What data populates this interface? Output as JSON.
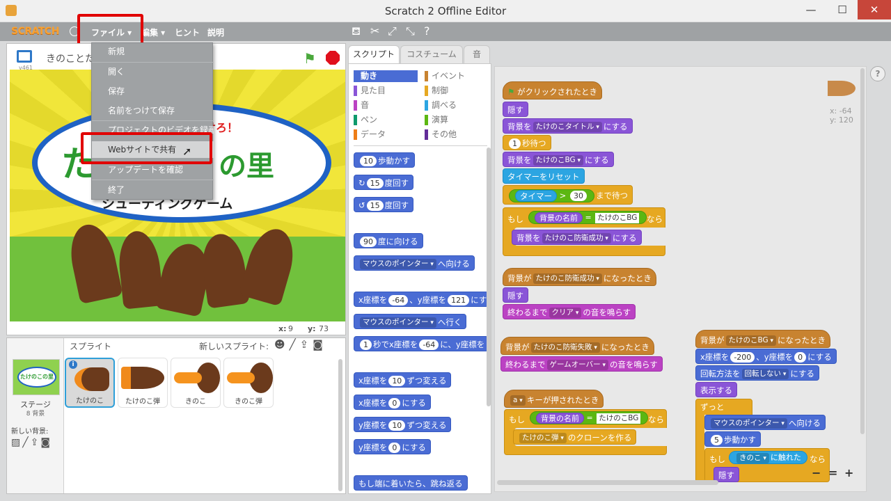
{
  "window": {
    "title": "Scratch 2 Offline Editor",
    "minimize": "—",
    "maximize": "☐",
    "close": "✕"
  },
  "menubar": {
    "logo": "SCRATCH",
    "file": "ファイル ▾",
    "edit": "編集 ▾",
    "tips": "ヒント",
    "about": "説明"
  },
  "file_menu": {
    "items": [
      "新規",
      "開く",
      "保存",
      "名前をつけて保存",
      "プロジェクトのビデオを録画...",
      "Webサイトで共有",
      "アップデートを確認",
      "終了"
    ]
  },
  "stage": {
    "project_title": "きのことた",
    "version": "v461",
    "game_title_red": "けろ！",
    "game_title_main_left": "た",
    "game_title_main_right": "の里",
    "game_subtitle": "シューティングゲーム",
    "x_label": "x:",
    "x_value": "9",
    "y_label": "y:",
    "y_value": "73"
  },
  "sprites": {
    "header": "スプライト",
    "new_sprite": "新しいスプライト:",
    "stage_label": "ステージ",
    "stage_count": "8 背景",
    "new_backdrop": "新しい背景:",
    "stage_thumb_title": "たけのこの里",
    "list": [
      {
        "name": "たけのこ"
      },
      {
        "name": "たけのこ弾"
      },
      {
        "name": "きのこ"
      },
      {
        "name": "きのこ弾"
      }
    ]
  },
  "tabs": [
    "スクリプト",
    "コスチューム",
    "音"
  ],
  "categories": {
    "left": [
      "動き",
      "見た目",
      "音",
      "ペン",
      "データ"
    ],
    "right": [
      "イベント",
      "制御",
      "調べる",
      "演算",
      "その他"
    ]
  },
  "palette": {
    "b1": {
      "pre": "10",
      "post": "歩動かす"
    },
    "b2": {
      "pre": "15",
      "post": "度回す"
    },
    "b3": {
      "pre": "15",
      "post": "度回す"
    },
    "b4": {
      "pre": "90",
      "post": "度に向ける"
    },
    "b5": {
      "pre": "マウスのポインター",
      "post": "へ向ける"
    },
    "b6": {
      "a": "x座標を",
      "b": "-64",
      "c": "、y座標を",
      "d": "121",
      "e": "にす"
    },
    "b7": {
      "pre": "マウスのポインター",
      "post": "へ行く"
    },
    "b8": {
      "a": "1",
      "b": "秒でx座標を",
      "c": "-64",
      "d": "に、y座標を"
    },
    "b9": {
      "a": "x座標を",
      "b": "10",
      "c": "ずつ変える"
    },
    "b10": {
      "a": "x座標を",
      "b": "0",
      "c": "にする"
    },
    "b11": {
      "a": "y座標を",
      "b": "10",
      "c": "ずつ変える"
    },
    "b12": {
      "a": "y座標を",
      "b": "0",
      "c": "にする"
    },
    "b13": {
      "a": "もし端に着いたら、跳ね返る"
    }
  },
  "scripts": {
    "s1": {
      "hat": "がクリックされたとき",
      "hide": "隠す",
      "bg1_a": "背景を",
      "bg1_b": "たけのこタイトル",
      "bg1_c": "にする",
      "wait_a": "1",
      "wait_b": "秒待つ",
      "bg2_a": "背景を",
      "bg2_b": "たけのこBG",
      "bg2_c": "にする",
      "timer_reset": "タイマーをリセット",
      "waituntil_a": "タイマー",
      "waituntil_b": ">",
      "waituntil_c": "30",
      "waituntil_d": "まで待つ",
      "if_a": "もし",
      "if_b": "背景の名前",
      "if_c": "=",
      "if_d": "たけのこBG",
      "if_e": "なら",
      "bg3_a": "背景を",
      "bg3_b": "たけのこ防衛成功",
      "bg3_c": "にする"
    },
    "s2": {
      "hat_a": "背景が",
      "hat_b": "たけのこ防衛成功",
      "hat_c": "になったとき",
      "hide": "隠す",
      "play_a": "終わるまで",
      "play_b": "クリア",
      "play_c": "の音を鳴らす"
    },
    "s3": {
      "hat_a": "背景が",
      "hat_b": "たけのこ防衛失敗",
      "hat_c": "になったとき",
      "play_a": "終わるまで",
      "play_b": "ゲームオーバー",
      "play_c": "の音を鳴らす"
    },
    "s4": {
      "hat_a": "a",
      "hat_b": "キーが押されたとき",
      "if_a": "もし",
      "if_b": "背景の名前",
      "if_c": "=",
      "if_d": "たけのこBG",
      "if_e": "なら",
      "clone_a": "たけのこ弾",
      "clone_b": "のクローンを作る"
    },
    "s5": {
      "hat_a": "背景が",
      "hat_b": "たけのこBG",
      "hat_c": "になったとき",
      "goto_a": "x座標を",
      "goto_b": "-200",
      "goto_c": "、y座標を",
      "goto_d": "0",
      "goto_e": "にする",
      "rot_a": "回転方法を",
      "rot_b": "回転しない",
      "rot_c": "にする",
      "show": "表示する",
      "forever": "ずっと",
      "point_a": "マウスのポインター",
      "point_b": "へ向ける",
      "move_a": "5",
      "move_b": "歩動かす",
      "if_a": "もし",
      "if_b": "きのこ",
      "if_c": "に触れた",
      "if_d": "なら",
      "hide": "隠す"
    },
    "sprite_info": {
      "x": "x: -64",
      "y": "y: 120"
    }
  },
  "zoom": {
    "out": "−",
    "reset": "=",
    "in": "+"
  }
}
